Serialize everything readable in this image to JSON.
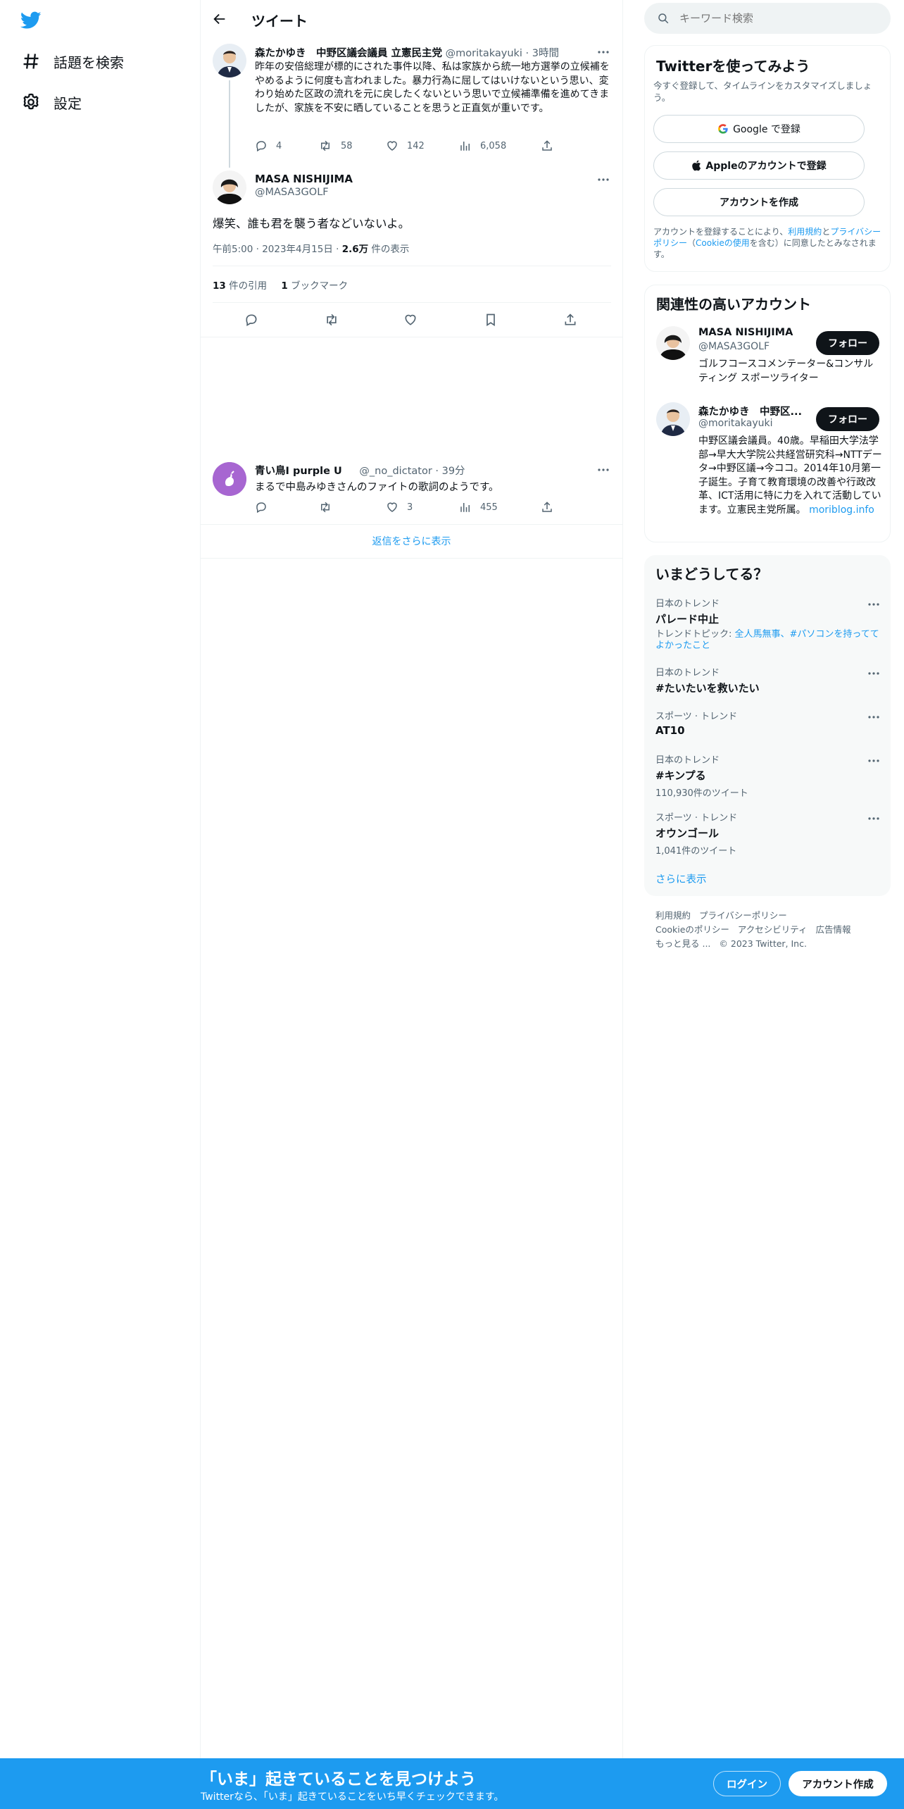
{
  "left_nav": {
    "items": [
      {
        "label": "話題を検索",
        "icon": "hashtag-icon"
      },
      {
        "label": "設定",
        "icon": "gear-icon"
      }
    ]
  },
  "header": {
    "title": "ツイート"
  },
  "parent_tweet": {
    "name": "森たかゆき　中野区議会議員 立憲民主党",
    "handle": "@moritakayuki",
    "time": "3時間",
    "text": "昨年の安倍総理が標的にされた事件以降、私は家族から統一地方選挙の立候補をやめるように何度も言われました。暴力行為に屈してはいけないという思い、変わり始めた区政の流れを元に戻したくないという思いで立候補準備を進めてきましたが、家族を不安に晒していることを思うと正直気が重いです。",
    "replies": "4",
    "retweets": "58",
    "likes": "142",
    "views": "6,058"
  },
  "main_tweet": {
    "name": "MASA NISHIJIMA",
    "handle": "@MASA3GOLF",
    "text": "爆笑、誰も君を襲う者などいないよ。",
    "time": "午前5:00",
    "date": "2023年4月15日",
    "views_count": "2.6万",
    "views_label": "件の表示",
    "quotes_count": "13",
    "quotes_label": "件の引用",
    "bookmarks_count": "1",
    "bookmarks_label": "ブックマーク"
  },
  "reply_tweet": {
    "name": "青い鳥I purple U",
    "handle": "@_no_dictator",
    "time": "39分",
    "text": "まるで中島みゆきさんのファイトの歌詞のようです。",
    "retweets": "",
    "likes": "3",
    "views": "455"
  },
  "show_more_replies": "返信をさらに表示",
  "search": {
    "placeholder": "キーワード検索"
  },
  "signup_card": {
    "title": "Twitterを使ってみよう",
    "subtitle": "今すぐ登録して、タイムラインをカスタマイズしましょう。",
    "google": "Google で登録",
    "apple": "Appleのアカウントで登録",
    "create": "アカウントを作成",
    "legal_1": "アカウントを登録することにより、",
    "legal_terms": "利用規約",
    "legal_and": "と",
    "legal_privacy": "プライバシーポリシー",
    "legal_paren_open": "（",
    "legal_cookie": "Cookieの使用",
    "legal_2": "を含む）に同意したとみなされます。"
  },
  "related": {
    "title": "関連性の高いアカウント",
    "follow_label": "フォロー",
    "accounts": [
      {
        "name": "MASA NISHIJIMA",
        "handle": "@MASA3GOLF",
        "bio": "ゴルフコースコメンテーター&コンサルティング スポーツライター"
      },
      {
        "name": "森たかゆき　中野区...",
        "handle": "@moritakayuki",
        "bio": "中野区議会議員。40歳。早稲田大学法学部→早大大学院公共経営研究科→NTTデータ→中野区議→今ココ。2014年10月第一子誕生。子育て教育環境の改善や行政改革、ICT活用に特に力を入れて活動しています。立憲民主党所属。",
        "link": "moriblog.info"
      }
    ]
  },
  "trends": {
    "title": "いまどうしてる？",
    "items": [
      {
        "category": "日本のトレンド",
        "name": "パレード中止",
        "sub_prefix": "トレンドトピック: ",
        "sub_links": "全人馬無事、#パソコンを持っててよかったこと"
      },
      {
        "category": "日本のトレンド",
        "name": "#たいたいを救いたい"
      },
      {
        "category": "スポーツ · トレンド",
        "name": "AT10"
      },
      {
        "category": "日本のトレンド",
        "name": "#キンプる",
        "sub": "110,930件のツイート"
      },
      {
        "category": "スポーツ · トレンド",
        "name": "オウンゴール",
        "sub": "1,041件のツイート"
      }
    ],
    "show_more": "さらに表示"
  },
  "footer": {
    "terms": "利用規約",
    "privacy": "プライバシーポリシー",
    "cookie": "Cookieのポリシー",
    "accessibility": "アクセシビリティ",
    "ads": "広告情報",
    "more": "もっと見る ...",
    "copyright": "© 2023 Twitter, Inc."
  },
  "bottom_bar": {
    "title": "「いま」起きていることを見つけよう",
    "subtitle": "Twitterなら、「いま」起きていることをいち早くチェックできます。",
    "login": "ログイン",
    "signup": "アカウント作成"
  },
  "colors": {
    "accent": "#1d9bf0",
    "text": "#0f1419",
    "muted": "#536471",
    "border": "#eff3f4"
  }
}
